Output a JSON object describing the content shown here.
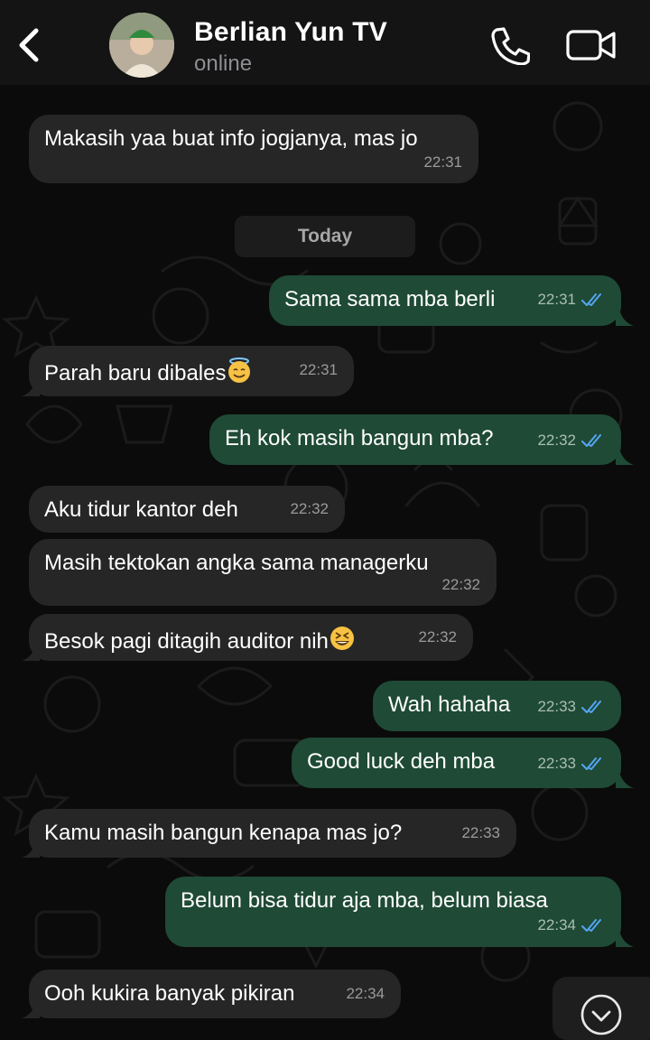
{
  "header": {
    "name": "Berlian Yun TV",
    "status": "online"
  },
  "icons": {
    "back": "chevron-left-icon",
    "call": "phone-icon",
    "video": "video-camera-icon",
    "read": "double-check-icon",
    "scroll": "chevron-down-circle-icon",
    "emoji_halo": "smiling-face-with-halo",
    "emoji_squint": "grinning-squinting-face"
  },
  "colors": {
    "incoming_bubble": "#262626",
    "outgoing_bubble": "#1f4a36",
    "read_tick": "#53a6f5",
    "header_bg": "#141414"
  },
  "date_divider": "Today",
  "messages": [
    {
      "dir": "in",
      "text": "Makasih yaa buat info jogjanya, mas jo",
      "time": "22:31"
    },
    {
      "dir": "out",
      "text": "Sama sama mba berli",
      "time": "22:31"
    },
    {
      "dir": "in",
      "text": "Parah baru dibales",
      "time": "22:31"
    },
    {
      "dir": "out",
      "text": "Eh kok masih bangun mba?",
      "time": "22:32"
    },
    {
      "dir": "in",
      "text": "Aku tidur kantor deh",
      "time": "22:32"
    },
    {
      "dir": "in",
      "text": "Masih tektokan angka sama managerku",
      "time": "22:32"
    },
    {
      "dir": "in",
      "text": "Besok pagi ditagih auditor nih",
      "time": "22:32"
    },
    {
      "dir": "out",
      "text": "Wah hahaha",
      "time": "22:33"
    },
    {
      "dir": "out",
      "text": "Good luck deh mba",
      "time": "22:33"
    },
    {
      "dir": "in",
      "text": "Kamu masih bangun kenapa mas jo?",
      "time": "22:33"
    },
    {
      "dir": "out",
      "text": "Belum bisa tidur aja mba, belum biasa",
      "time": "22:34"
    },
    {
      "dir": "in",
      "text": "Ooh kukira banyak pikiran",
      "time": "22:34"
    }
  ]
}
